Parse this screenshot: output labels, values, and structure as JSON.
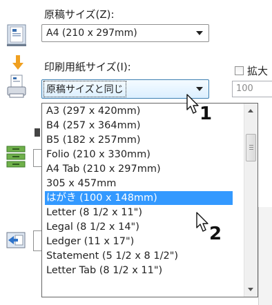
{
  "original_size": {
    "label": "原稿サイズ(Z):",
    "value": "A4 (210 x 297mm)"
  },
  "print_paper_size": {
    "label": "印刷用紙サイズ(I):",
    "value": "原稿サイズと同じ"
  },
  "zoom": {
    "checkbox_label": "拡大",
    "value": "100"
  },
  "dropdown": {
    "items": [
      "A3 (297 x 420mm)",
      "B4 (257 x 364mm)",
      "B5 (182 x 257mm)",
      "Folio (210 x 330mm)",
      "A4 Tab (210 x 297mm)",
      "305 x 457mm",
      "はがき (100 x 148mm)",
      "Letter (8 1/2 x 11\")",
      "Legal (8 1/2 x 14\")",
      "Ledger (11 x 17\")",
      "Statement (5 1/2 x 8 1/2\")",
      "Letter Tab (8 1/2 x 11\")"
    ],
    "selected_index": 6
  },
  "callouts": {
    "first": "1",
    "second": "2"
  },
  "colors": {
    "selection": "#3399ff",
    "arrow_orange": "#f0a020"
  }
}
